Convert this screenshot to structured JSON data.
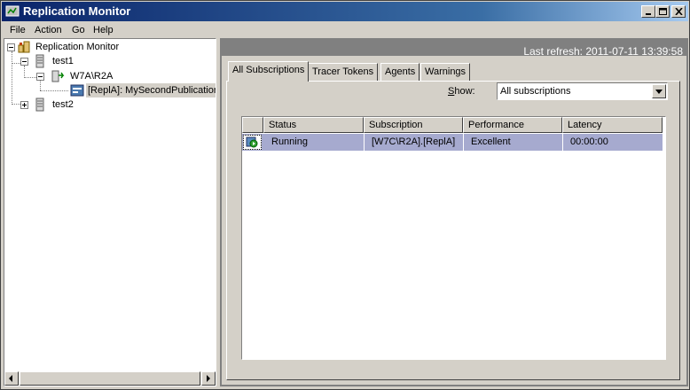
{
  "window": {
    "title": "Replication Monitor"
  },
  "menu": [
    "File",
    "Action",
    "Go",
    "Help"
  ],
  "tree": {
    "root": "Replication Monitor",
    "publisher1": "test1",
    "instance": "W7A\\R2A",
    "publication": "[ReplA]: MySecondPublication",
    "publisher2": "test2"
  },
  "status": {
    "last_refresh": "Last refresh: 2011-07-11 13:39:58"
  },
  "tabs": [
    "All Subscriptions",
    "Tracer Tokens",
    "Agents",
    "Warnings"
  ],
  "filter": {
    "label_prefix": "",
    "label_underlined": "S",
    "label_suffix": "how:",
    "value": "All subscriptions"
  },
  "table": {
    "columns": [
      "Status",
      "Subscription",
      "Performance",
      "Latency"
    ],
    "rows": [
      {
        "status": "Running",
        "subscription": "[W7C\\R2A].[ReplA]",
        "performance": "Excellent",
        "latency": "00:00:00"
      }
    ]
  }
}
